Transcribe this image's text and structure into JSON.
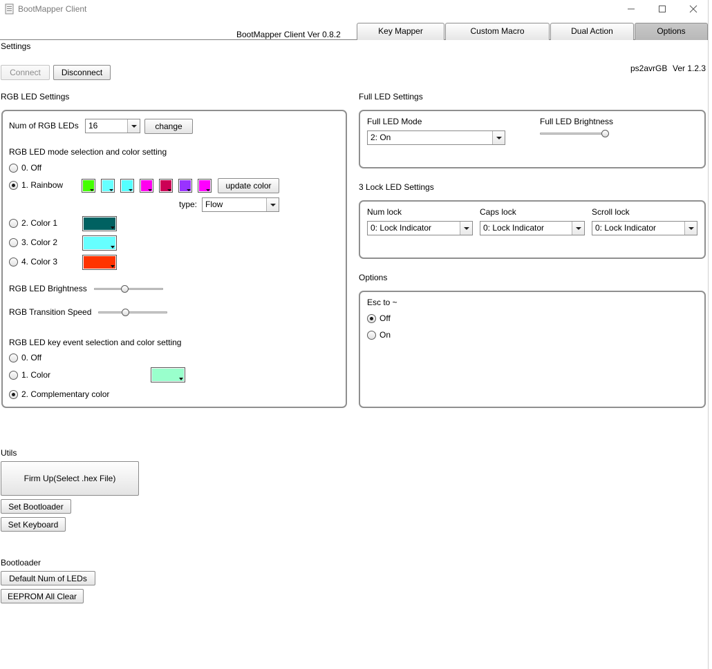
{
  "window": {
    "title": "BootMapper Client"
  },
  "header": {
    "version": "BootMapper Client Ver 0.8.2"
  },
  "tabs": [
    {
      "label": "Key Mapper"
    },
    {
      "label": "Custom Macro"
    },
    {
      "label": "Dual Action"
    },
    {
      "label": "Options"
    }
  ],
  "page": {
    "title": "Settings"
  },
  "connection": {
    "connect_label": "Connect",
    "disconnect_label": "Disconnect"
  },
  "device": {
    "name": "ps2avrGB",
    "version": "Ver 1.2.3"
  },
  "rgb": {
    "section_title": "RGB LED Settings",
    "num_label": "Num of RGB LEDs",
    "num_value": "16",
    "change_label": "change",
    "mode_title": "RGB LED mode selection and color setting",
    "modes": [
      {
        "label": "0. Off",
        "checked": false
      },
      {
        "label": "1. Rainbow",
        "checked": true
      },
      {
        "label": "2. Color 1",
        "checked": false
      },
      {
        "label": "3. Color 2",
        "checked": false
      },
      {
        "label": "4. Color 3",
        "checked": false
      }
    ],
    "rainbow_colors": [
      "#44ff00",
      "#66ffff",
      "#55ffff",
      "#ff00ee",
      "#cc0055",
      "#9933ff",
      "#ff00ff"
    ],
    "update_color_label": "update color",
    "type_label": "type:",
    "type_value": "Flow",
    "color1": "#006161",
    "color2": "#66ffff",
    "color3": "#ff3300",
    "brightness_label": "RGB LED Brightness",
    "brightness_level": 0.45,
    "speed_label": "RGB Transition Speed",
    "speed_level": 0.4,
    "key_event_title": "RGB LED key event selection and color setting",
    "key_events": [
      {
        "label": "0. Off",
        "checked": false
      },
      {
        "label": "1. Color",
        "checked": false
      },
      {
        "label": "2. Complementary color",
        "checked": true
      }
    ],
    "key_event_color": "#99ffcc"
  },
  "full_led": {
    "section_title": "Full LED Settings",
    "mode_label": "Full LED Mode",
    "mode_value": "2: On",
    "brightness_label": "Full LED Brightness",
    "brightness_level": 0.95
  },
  "lock_led": {
    "section_title": "3 Lock LED Settings",
    "num_label": "Num lock",
    "num_value": "0: Lock Indicator",
    "caps_label": "Caps lock",
    "caps_value": "0: Lock Indicator",
    "scroll_label": "Scroll lock",
    "scroll_value": "0: Lock Indicator"
  },
  "options": {
    "section_title": "Options",
    "esc_label": "Esc to ~",
    "choices": [
      {
        "label": "Off",
        "checked": true
      },
      {
        "label": "On",
        "checked": false
      }
    ]
  },
  "utils": {
    "section_title": "Utils",
    "firmup_label": "Firm Up(Select .hex File)",
    "set_bootloader_label": "Set Bootloader",
    "set_keyboard_label": "Set Keyboard"
  },
  "bootloader": {
    "section_title": "Bootloader",
    "default_num_label": "Default Num of LEDs",
    "eeprom_clear_label": "EEPROM All Clear"
  }
}
